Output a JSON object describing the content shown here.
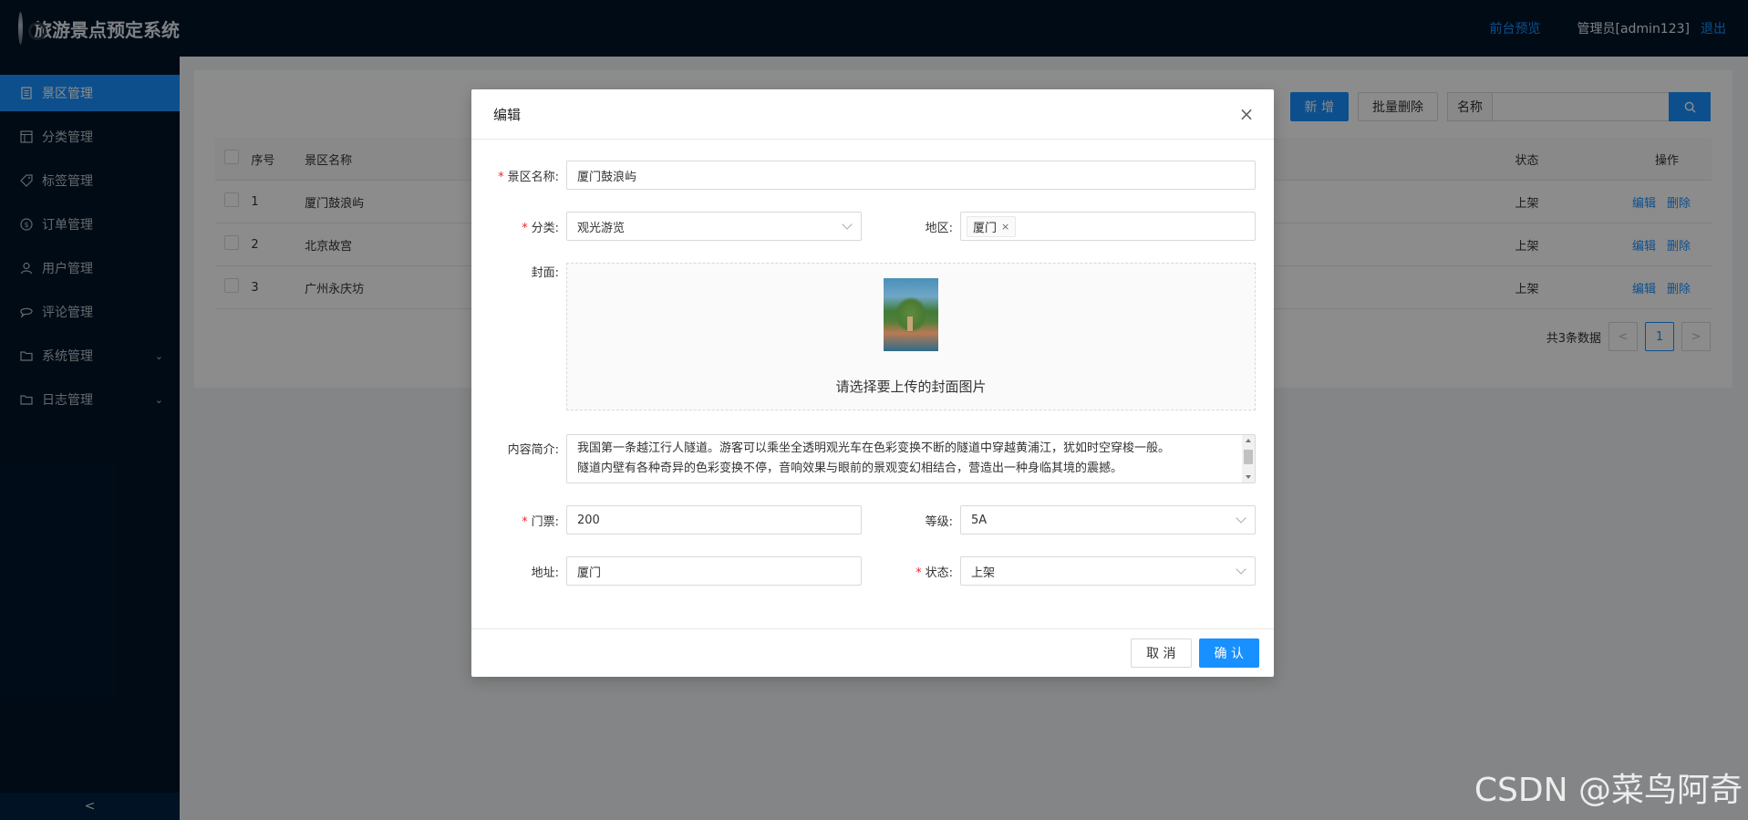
{
  "header": {
    "title": "旅游景点预定系统",
    "front_preview": "前台预览",
    "admin": "管理员[admin123]",
    "logout": "退出"
  },
  "sidebar": {
    "items": [
      {
        "label": "景区管理",
        "icon": "document-icon",
        "active": true
      },
      {
        "label": "分类管理",
        "icon": "layout-icon"
      },
      {
        "label": "标签管理",
        "icon": "tag-icon"
      },
      {
        "label": "订单管理",
        "icon": "dollar-icon"
      },
      {
        "label": "用户管理",
        "icon": "user-icon"
      },
      {
        "label": "评论管理",
        "icon": "comment-icon"
      },
      {
        "label": "系统管理",
        "icon": "folder-icon",
        "expandable": true
      },
      {
        "label": "日志管理",
        "icon": "folder-icon",
        "expandable": true
      }
    ],
    "collapse": "<"
  },
  "toolbar": {
    "add": "新 增",
    "batch_delete": "批量删除",
    "search_label": "名称",
    "search_placeholder": ""
  },
  "table": {
    "headers": {
      "index": "序号",
      "name": "景区名称",
      "status": "状态",
      "ops": "操作"
    },
    "rows": [
      {
        "index": "1",
        "name": "厦门鼓浪屿",
        "status": "上架",
        "edit": "编辑",
        "delete": "删除"
      },
      {
        "index": "2",
        "name": "北京故宫",
        "status": "上架",
        "edit": "编辑",
        "delete": "删除"
      },
      {
        "index": "3",
        "name": "广州永庆坊",
        "status": "上架",
        "edit": "编辑",
        "delete": "删除"
      }
    ]
  },
  "pagination": {
    "total": "共3条数据",
    "current": "1",
    "prev": "<",
    "next": ">"
  },
  "modal": {
    "title": "编辑",
    "close": "×",
    "fields": {
      "name_label": "景区名称:",
      "name_value": "厦门鼓浪屿",
      "category_label": "分类:",
      "category_value": "观光游览",
      "region_label": "地区:",
      "region_tag": "厦门",
      "cover_label": "封面:",
      "upload_hint": "请选择要上传的封面图片",
      "intro_label": "内容简介:",
      "intro_line1": "我国第一条越江行人隧道。游客可以乘坐全透明观光车在色彩变换不断的隧道中穿越黄浦江，犹如时空穿梭一般。",
      "intro_line2": "隧道内壁有各种奇异的色彩变换不停，音响效果与眼前的景观变幻相结合，营造出一种身临其境的震撼。",
      "ticket_label": "门票:",
      "ticket_value": "200",
      "level_label": "等级:",
      "level_value": "5A",
      "address_label": "地址:",
      "address_value": "厦门",
      "status_label": "状态:",
      "status_value": "上架"
    },
    "cancel": "取 消",
    "confirm": "确 认"
  },
  "watermark": "CSDN @菜鸟阿奇",
  "colors": {
    "primary": "#1890ff",
    "dark_bg": "#001529",
    "required": "#f5222d"
  }
}
